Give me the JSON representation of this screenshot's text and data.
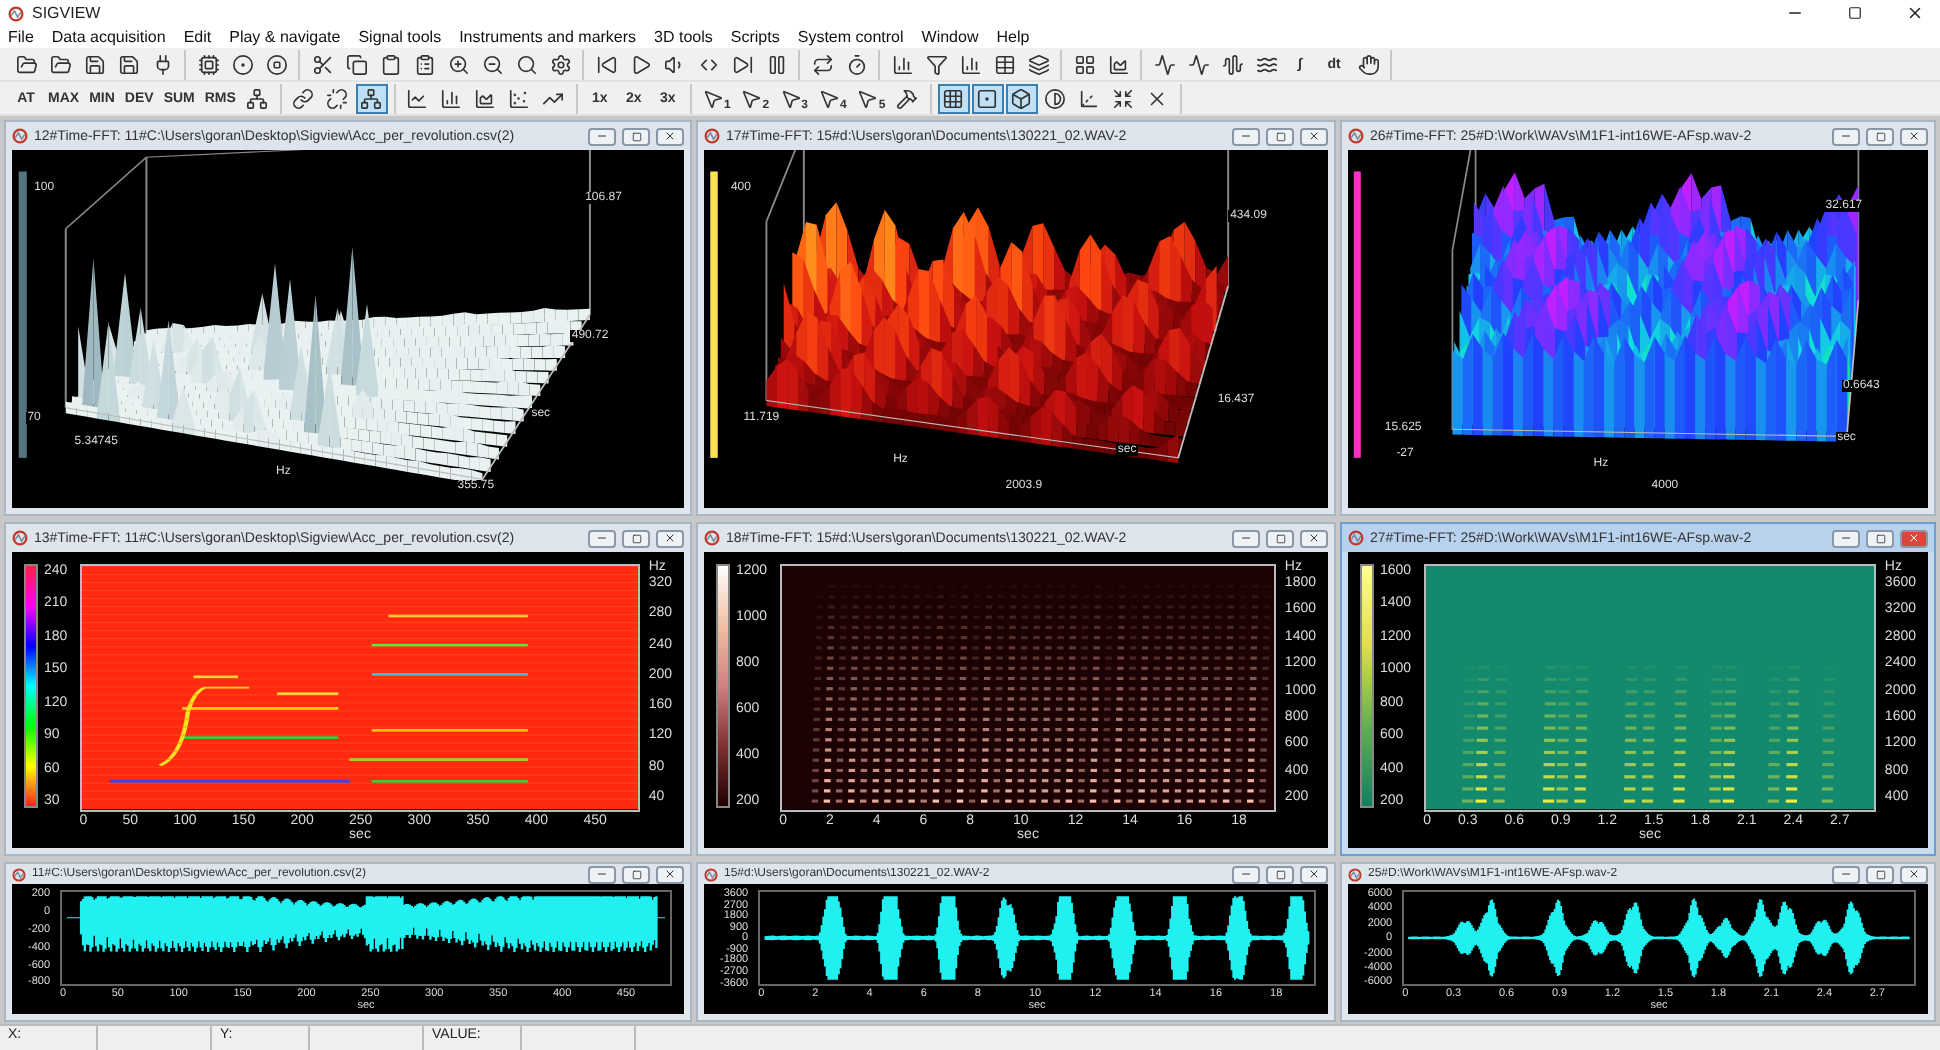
{
  "app": {
    "title": "SIGVIEW"
  },
  "menu": [
    "File",
    "Data acquisition",
    "Edit",
    "Play & navigate",
    "Signal tools",
    "Instruments and markers",
    "3D tools",
    "Scripts",
    "System control",
    "Window",
    "Help"
  ],
  "toolbars": [
    {
      "groups": [
        {
          "buttons": [
            {
              "kind": "open",
              "pressed": false
            },
            {
              "kind": "open",
              "pressed": false
            },
            {
              "kind": "save",
              "pressed": false
            },
            {
              "kind": "save",
              "pressed": false
            },
            {
              "kind": "plug",
              "pressed": false
            }
          ]
        },
        {
          "buttons": [
            {
              "kind": "chip",
              "pressed": false
            },
            {
              "kind": "record",
              "pressed": false
            },
            {
              "kind": "stop",
              "pressed": false
            }
          ]
        },
        {
          "buttons": [
            {
              "kind": "cut",
              "pressed": false
            },
            {
              "kind": "copy",
              "pressed": false
            },
            {
              "kind": "paste",
              "pressed": false
            },
            {
              "kind": "paste-list",
              "pressed": false
            },
            {
              "kind": "zoom-in",
              "pressed": false
            },
            {
              "kind": "zoom-out",
              "pressed": false
            },
            {
              "kind": "search",
              "pressed": false
            },
            {
              "kind": "settings",
              "pressed": false
            }
          ]
        },
        {
          "buttons": [
            {
              "kind": "first",
              "pressed": false
            },
            {
              "kind": "play",
              "pressed": false
            },
            {
              "kind": "volume",
              "pressed": false
            },
            {
              "kind": "range",
              "pressed": false
            },
            {
              "kind": "last",
              "pressed": false
            },
            {
              "kind": "pause",
              "pressed": false
            }
          ]
        },
        {
          "buttons": [
            {
              "kind": "loop",
              "pressed": false
            },
            {
              "kind": "timer",
              "pressed": false
            }
          ]
        },
        {
          "buttons": [
            {
              "kind": "bars",
              "pressed": false
            },
            {
              "kind": "filter",
              "pressed": false
            },
            {
              "kind": "bars",
              "pressed": false
            },
            {
              "kind": "table",
              "pressed": false
            },
            {
              "kind": "layers",
              "pressed": false
            }
          ]
        },
        {
          "buttons": [
            {
              "kind": "grid",
              "pressed": false
            },
            {
              "kind": "area",
              "pressed": false
            }
          ]
        },
        {
          "buttons": [
            {
              "kind": "pulse",
              "pressed": false
            },
            {
              "kind": "pulse",
              "pressed": false
            },
            {
              "kind": "waveform",
              "pressed": false
            },
            {
              "kind": "waves",
              "pressed": false
            },
            {
              "kind": "label",
              "label": "∫",
              "pressed": false
            },
            {
              "kind": "label",
              "label": "dt",
              "pressed": false
            },
            {
              "kind": "hand",
              "pressed": false
            }
          ]
        }
      ]
    },
    {
      "groups": [
        {
          "buttons": [
            {
              "kind": "label",
              "label": "AT",
              "pressed": false
            },
            {
              "kind": "label",
              "label": "MAX",
              "pressed": false
            },
            {
              "kind": "label",
              "label": "MIN",
              "pressed": false
            },
            {
              "kind": "label",
              "label": "DEV",
              "pressed": false
            },
            {
              "kind": "label",
              "label": "SUM",
              "pressed": false
            },
            {
              "kind": "label",
              "label": "RMS",
              "pressed": false
            },
            {
              "kind": "network",
              "pressed": false
            }
          ]
        },
        {
          "buttons": [
            {
              "kind": "link",
              "pressed": false
            },
            {
              "kind": "unlink",
              "pressed": false
            },
            {
              "kind": "network",
              "pressed": true
            }
          ]
        },
        {
          "buttons": [
            {
              "kind": "line",
              "pressed": false
            },
            {
              "kind": "bars",
              "pressed": false
            },
            {
              "kind": "area",
              "pressed": false
            },
            {
              "kind": "scatter",
              "pressed": false
            },
            {
              "kind": "trend",
              "pressed": false
            }
          ]
        },
        {
          "buttons": [
            {
              "kind": "label",
              "label": "1x",
              "pressed": false
            },
            {
              "kind": "label",
              "label": "2x",
              "pressed": false
            },
            {
              "kind": "label",
              "label": "3x",
              "pressed": false
            }
          ]
        },
        {
          "buttons": [
            {
              "kind": "cursor",
              "label": "1",
              "pressed": false
            },
            {
              "kind": "cursor",
              "label": "2",
              "pressed": false
            },
            {
              "kind": "cursor",
              "label": "3",
              "pressed": false
            },
            {
              "kind": "cursor",
              "label": "4",
              "pressed": false
            },
            {
              "kind": "cursor",
              "label": "5",
              "pressed": false
            },
            {
              "kind": "hammer",
              "pressed": false
            }
          ]
        },
        {
          "buttons": [
            {
              "kind": "grid3d",
              "pressed": true
            },
            {
              "kind": "target",
              "pressed": true
            },
            {
              "kind": "cube",
              "pressed": true
            },
            {
              "kind": "contrast",
              "pressed": false
            },
            {
              "kind": "axes",
              "pressed": false
            },
            {
              "kind": "shrink",
              "pressed": false
            },
            {
              "kind": "close",
              "pressed": false
            }
          ]
        }
      ]
    }
  ],
  "windows": [
    {
      "kind": "surface",
      "title": "12#Time-FFT:  11#C:\\Users\\goran\\Desktop\\Sigview\\Acc_per_revolution.csv(2)",
      "active": false,
      "labels": [
        "100",
        "70",
        "106.87",
        "490.72",
        "5.34745",
        "355.75",
        "Hz",
        "sec"
      ]
    },
    {
      "kind": "surface",
      "title": "17#Time-FFT:  15#d:\\Users\\goran\\Documents\\130221_02.WAV-2",
      "active": false,
      "labels": [
        "400",
        "11.719",
        "434.09",
        "16.437",
        "2003.9",
        "Hz",
        "sec"
      ]
    },
    {
      "kind": "surface",
      "title": "26#Time-FFT:  25#D:\\Work\\WAVs\\M1F1-int16WE-AFsp.wav-2",
      "active": false,
      "labels": [
        "32.617",
        "15.625",
        "-27",
        "0.6643",
        "4000",
        "Hz",
        "sec"
      ]
    },
    {
      "kind": "spectrogram",
      "title": "13#Time-FFT:  11#C:\\Users\\goran\\Desktop\\Sigview\\Acc_per_revolution.csv(2)",
      "active": false,
      "scale_ticks": [
        "240",
        "210",
        "180",
        "150",
        "120",
        "90",
        "60",
        "30"
      ],
      "y_unit": "Hz",
      "y_ticks": [
        "320",
        "280",
        "240",
        "200",
        "160",
        "120",
        "80",
        "40"
      ],
      "x_ticks": [
        "0",
        "50",
        "100",
        "150",
        "200",
        "250",
        "300",
        "350",
        "400",
        "450"
      ],
      "x_label": "sec"
    },
    {
      "kind": "spectrogram",
      "title": "18#Time-FFT:  15#d:\\Users\\goran\\Documents\\130221_02.WAV-2",
      "active": false,
      "scale_ticks": [
        "1200",
        "1000",
        "800",
        "600",
        "400",
        "200"
      ],
      "y_unit": "Hz",
      "y_ticks": [
        "1800",
        "1600",
        "1400",
        "1200",
        "1000",
        "800",
        "600",
        "400",
        "200"
      ],
      "x_ticks": [
        "0",
        "2",
        "4",
        "6",
        "8",
        "10",
        "12",
        "14",
        "16",
        "18"
      ],
      "x_label": "sec"
    },
    {
      "kind": "spectrogram",
      "title": "27#Time-FFT:  25#D:\\Work\\WAVs\\M1F1-int16WE-AFsp.wav-2",
      "active": true,
      "scale_ticks": [
        "1600",
        "1400",
        "1200",
        "1000",
        "800",
        "600",
        "400",
        "200"
      ],
      "y_unit": "Hz",
      "y_ticks": [
        "3600",
        "3200",
        "2800",
        "2400",
        "2000",
        "1600",
        "1200",
        "800",
        "400"
      ],
      "x_ticks": [
        "0",
        "0.3",
        "0.6",
        "0.9",
        "1.2",
        "1.5",
        "1.8",
        "2.1",
        "2.4",
        "2.7"
      ],
      "x_label": "sec"
    },
    {
      "kind": "waveform",
      "title": "11#C:\\Users\\goran\\Desktop\\Sigview\\Acc_per_revolution.csv(2)",
      "active": false,
      "y_ticks": [
        "200",
        "0",
        "-200",
        "-400",
        "-600",
        "-800"
      ],
      "x_ticks": [
        "0",
        "50",
        "100",
        "150",
        "200",
        "250",
        "300",
        "350",
        "400",
        "450"
      ],
      "x_label": "sec"
    },
    {
      "kind": "waveform",
      "title": "15#d:\\Users\\goran\\Documents\\130221_02.WAV-2",
      "active": false,
      "y_ticks": [
        "3600",
        "2700",
        "1800",
        "900",
        "0",
        "-900",
        "-1800",
        "-2700",
        "-3600"
      ],
      "x_ticks": [
        "0",
        "2",
        "4",
        "6",
        "8",
        "10",
        "12",
        "14",
        "16",
        "18"
      ],
      "x_label": "sec"
    },
    {
      "kind": "waveform",
      "title": "25#D:\\Work\\WAVs\\M1F1-int16WE-AFsp.wav-2",
      "active": false,
      "y_ticks": [
        "6000",
        "4000",
        "2000",
        "0",
        "-2000",
        "-4000",
        "-6000"
      ],
      "x_ticks": [
        "0",
        "0.3",
        "0.6",
        "0.9",
        "1.2",
        "1.5",
        "1.8",
        "2.1",
        "2.4",
        "2.7"
      ],
      "x_label": "sec"
    }
  ],
  "status_bar": [
    {
      "label": "X:"
    },
    {
      "label": "Y:"
    },
    {
      "label": "VALUE:"
    }
  ]
}
